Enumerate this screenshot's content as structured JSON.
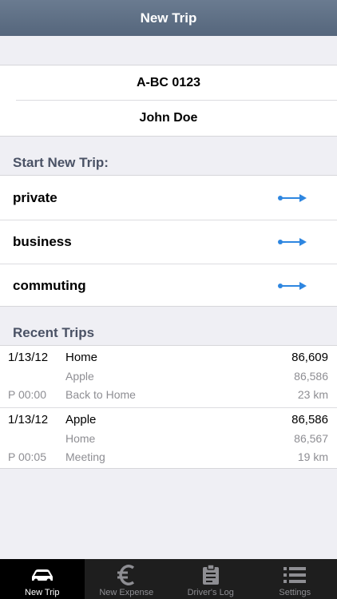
{
  "navbar": {
    "title": "New Trip"
  },
  "vehicle": {
    "plate": "A-BC 0123",
    "driver": "John Doe"
  },
  "start_section": {
    "header": "Start New Trip:"
  },
  "trip_types": [
    {
      "label": "private",
      "icon": "arrow-right-icon"
    },
    {
      "label": "business",
      "icon": "arrow-right-icon"
    },
    {
      "label": "commuting",
      "icon": "arrow-right-icon"
    }
  ],
  "recent_section": {
    "header": "Recent Trips"
  },
  "recent_trips": [
    {
      "date": "1/13/12",
      "to": "Home",
      "to_odometer": "86,609",
      "from": "Apple",
      "from_odometer": "86,586",
      "time": "P 00:00",
      "purpose": "Back to Home",
      "distance": "23 km"
    },
    {
      "date": "1/13/12",
      "to": "Apple",
      "to_odometer": "86,586",
      "from": "Home",
      "from_odometer": "86,567",
      "time": "P 00:05",
      "purpose": "Meeting",
      "distance": "19 km"
    }
  ],
  "tabbar": [
    {
      "label": "New Trip",
      "icon": "car-icon",
      "active": true
    },
    {
      "label": "New Expense",
      "icon": "euro-icon",
      "active": false
    },
    {
      "label": "Driver's Log",
      "icon": "clipboard-icon",
      "active": false
    },
    {
      "label": "Settings",
      "icon": "list-icon",
      "active": false
    }
  ],
  "colors": {
    "navbar": "#5f7086",
    "accent": "#2e86e0",
    "tabbar": "#1e1e1e",
    "section_header": "#4a5265"
  }
}
